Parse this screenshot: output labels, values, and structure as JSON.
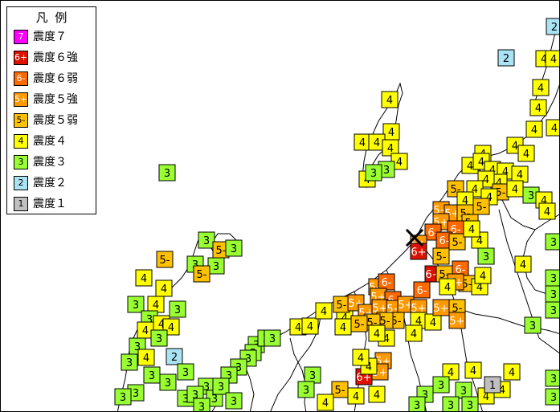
{
  "legend": {
    "title": "凡 例",
    "items": [
      {
        "code": "7",
        "label": "震度７",
        "color": "#ff00ff",
        "text_color": "#ffffff"
      },
      {
        "code": "6+",
        "label": "震度６強",
        "color": "#dd1100",
        "text_color": "#ffffff"
      },
      {
        "code": "6-",
        "label": "震度６弱",
        "color": "#ff6a00",
        "text_color": "#ffffff"
      },
      {
        "code": "5+",
        "label": "震度５強",
        "color": "#ff9900",
        "text_color": "#ffffff"
      },
      {
        "code": "5-",
        "label": "震度５弱",
        "color": "#ffc000",
        "text_color": "#000000"
      },
      {
        "code": "4",
        "label": "震度４",
        "color": "#ffff00",
        "text_color": "#000000"
      },
      {
        "code": "3",
        "label": "震度３",
        "color": "#99ff33",
        "text_color": "#000000"
      },
      {
        "code": "2",
        "label": "震度２",
        "color": "#aae4f4",
        "text_color": "#000000"
      },
      {
        "code": "1",
        "label": "震度１",
        "color": "#bfbfbf",
        "text_color": "#000000"
      }
    ]
  },
  "epicenter_icon": "x-mark-icon",
  "stations": {
    "intensity_7": [],
    "intensity_6_strong": [
      "6+",
      "6+",
      "6+"
    ],
    "intensity_6_weak": [
      "6-",
      "6-",
      "6-",
      "6-",
      "6-",
      "6-",
      "6-",
      "6-"
    ],
    "intensity_5_strong": [
      "5+",
      "5+",
      "5+",
      "5+",
      "5+",
      "5+",
      "5+",
      "5+",
      "5+",
      "5+"
    ],
    "intensity_5_weak": [
      "5-",
      "5-",
      "5-",
      "5-",
      "5-",
      "5-",
      "5-",
      "5-",
      "5-",
      "5-",
      "5-",
      "5-"
    ],
    "intensity_4": [
      "4"
    ],
    "intensity_3": [
      "3"
    ],
    "intensity_2": [
      "2"
    ],
    "intensity_1": [
      "1"
    ]
  }
}
